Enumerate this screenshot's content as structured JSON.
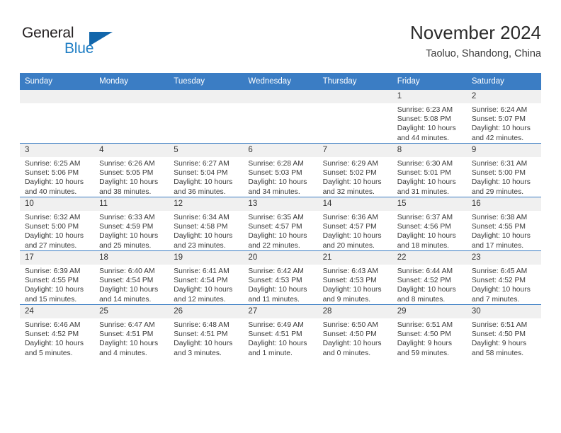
{
  "logo": {
    "word_one": "General",
    "word_two": "Blue",
    "triangle_color": "#1266ab"
  },
  "header": {
    "title": "November 2024",
    "subtitle": "Taoluo, Shandong, China"
  },
  "theme": {
    "header_bar": "#3b7dc4",
    "day_band": "#f0f0f0",
    "text": "#3a3a3a"
  },
  "weekday_headers": [
    "Sunday",
    "Monday",
    "Tuesday",
    "Wednesday",
    "Thursday",
    "Friday",
    "Saturday"
  ],
  "weeks": [
    [
      {
        "day": "",
        "sunrise": "",
        "sunset": "",
        "daylight": "",
        "empty": true
      },
      {
        "day": "",
        "sunrise": "",
        "sunset": "",
        "daylight": "",
        "empty": true
      },
      {
        "day": "",
        "sunrise": "",
        "sunset": "",
        "daylight": "",
        "empty": true
      },
      {
        "day": "",
        "sunrise": "",
        "sunset": "",
        "daylight": "",
        "empty": true
      },
      {
        "day": "",
        "sunrise": "",
        "sunset": "",
        "daylight": "",
        "empty": true
      },
      {
        "day": "1",
        "sunrise": "Sunrise: 6:23 AM",
        "sunset": "Sunset: 5:08 PM",
        "daylight": "Daylight: 10 hours and 44 minutes."
      },
      {
        "day": "2",
        "sunrise": "Sunrise: 6:24 AM",
        "sunset": "Sunset: 5:07 PM",
        "daylight": "Daylight: 10 hours and 42 minutes."
      }
    ],
    [
      {
        "day": "3",
        "sunrise": "Sunrise: 6:25 AM",
        "sunset": "Sunset: 5:06 PM",
        "daylight": "Daylight: 10 hours and 40 minutes."
      },
      {
        "day": "4",
        "sunrise": "Sunrise: 6:26 AM",
        "sunset": "Sunset: 5:05 PM",
        "daylight": "Daylight: 10 hours and 38 minutes."
      },
      {
        "day": "5",
        "sunrise": "Sunrise: 6:27 AM",
        "sunset": "Sunset: 5:04 PM",
        "daylight": "Daylight: 10 hours and 36 minutes."
      },
      {
        "day": "6",
        "sunrise": "Sunrise: 6:28 AM",
        "sunset": "Sunset: 5:03 PM",
        "daylight": "Daylight: 10 hours and 34 minutes."
      },
      {
        "day": "7",
        "sunrise": "Sunrise: 6:29 AM",
        "sunset": "Sunset: 5:02 PM",
        "daylight": "Daylight: 10 hours and 32 minutes."
      },
      {
        "day": "8",
        "sunrise": "Sunrise: 6:30 AM",
        "sunset": "Sunset: 5:01 PM",
        "daylight": "Daylight: 10 hours and 31 minutes."
      },
      {
        "day": "9",
        "sunrise": "Sunrise: 6:31 AM",
        "sunset": "Sunset: 5:00 PM",
        "daylight": "Daylight: 10 hours and 29 minutes."
      }
    ],
    [
      {
        "day": "10",
        "sunrise": "Sunrise: 6:32 AM",
        "sunset": "Sunset: 5:00 PM",
        "daylight": "Daylight: 10 hours and 27 minutes."
      },
      {
        "day": "11",
        "sunrise": "Sunrise: 6:33 AM",
        "sunset": "Sunset: 4:59 PM",
        "daylight": "Daylight: 10 hours and 25 minutes."
      },
      {
        "day": "12",
        "sunrise": "Sunrise: 6:34 AM",
        "sunset": "Sunset: 4:58 PM",
        "daylight": "Daylight: 10 hours and 23 minutes."
      },
      {
        "day": "13",
        "sunrise": "Sunrise: 6:35 AM",
        "sunset": "Sunset: 4:57 PM",
        "daylight": "Daylight: 10 hours and 22 minutes."
      },
      {
        "day": "14",
        "sunrise": "Sunrise: 6:36 AM",
        "sunset": "Sunset: 4:57 PM",
        "daylight": "Daylight: 10 hours and 20 minutes."
      },
      {
        "day": "15",
        "sunrise": "Sunrise: 6:37 AM",
        "sunset": "Sunset: 4:56 PM",
        "daylight": "Daylight: 10 hours and 18 minutes."
      },
      {
        "day": "16",
        "sunrise": "Sunrise: 6:38 AM",
        "sunset": "Sunset: 4:55 PM",
        "daylight": "Daylight: 10 hours and 17 minutes."
      }
    ],
    [
      {
        "day": "17",
        "sunrise": "Sunrise: 6:39 AM",
        "sunset": "Sunset: 4:55 PM",
        "daylight": "Daylight: 10 hours and 15 minutes."
      },
      {
        "day": "18",
        "sunrise": "Sunrise: 6:40 AM",
        "sunset": "Sunset: 4:54 PM",
        "daylight": "Daylight: 10 hours and 14 minutes."
      },
      {
        "day": "19",
        "sunrise": "Sunrise: 6:41 AM",
        "sunset": "Sunset: 4:54 PM",
        "daylight": "Daylight: 10 hours and 12 minutes."
      },
      {
        "day": "20",
        "sunrise": "Sunrise: 6:42 AM",
        "sunset": "Sunset: 4:53 PM",
        "daylight": "Daylight: 10 hours and 11 minutes."
      },
      {
        "day": "21",
        "sunrise": "Sunrise: 6:43 AM",
        "sunset": "Sunset: 4:53 PM",
        "daylight": "Daylight: 10 hours and 9 minutes."
      },
      {
        "day": "22",
        "sunrise": "Sunrise: 6:44 AM",
        "sunset": "Sunset: 4:52 PM",
        "daylight": "Daylight: 10 hours and 8 minutes."
      },
      {
        "day": "23",
        "sunrise": "Sunrise: 6:45 AM",
        "sunset": "Sunset: 4:52 PM",
        "daylight": "Daylight: 10 hours and 7 minutes."
      }
    ],
    [
      {
        "day": "24",
        "sunrise": "Sunrise: 6:46 AM",
        "sunset": "Sunset: 4:52 PM",
        "daylight": "Daylight: 10 hours and 5 minutes."
      },
      {
        "day": "25",
        "sunrise": "Sunrise: 6:47 AM",
        "sunset": "Sunset: 4:51 PM",
        "daylight": "Daylight: 10 hours and 4 minutes."
      },
      {
        "day": "26",
        "sunrise": "Sunrise: 6:48 AM",
        "sunset": "Sunset: 4:51 PM",
        "daylight": "Daylight: 10 hours and 3 minutes."
      },
      {
        "day": "27",
        "sunrise": "Sunrise: 6:49 AM",
        "sunset": "Sunset: 4:51 PM",
        "daylight": "Daylight: 10 hours and 1 minute."
      },
      {
        "day": "28",
        "sunrise": "Sunrise: 6:50 AM",
        "sunset": "Sunset: 4:50 PM",
        "daylight": "Daylight: 10 hours and 0 minutes."
      },
      {
        "day": "29",
        "sunrise": "Sunrise: 6:51 AM",
        "sunset": "Sunset: 4:50 PM",
        "daylight": "Daylight: 9 hours and 59 minutes."
      },
      {
        "day": "30",
        "sunrise": "Sunrise: 6:51 AM",
        "sunset": "Sunset: 4:50 PM",
        "daylight": "Daylight: 9 hours and 58 minutes."
      }
    ]
  ]
}
